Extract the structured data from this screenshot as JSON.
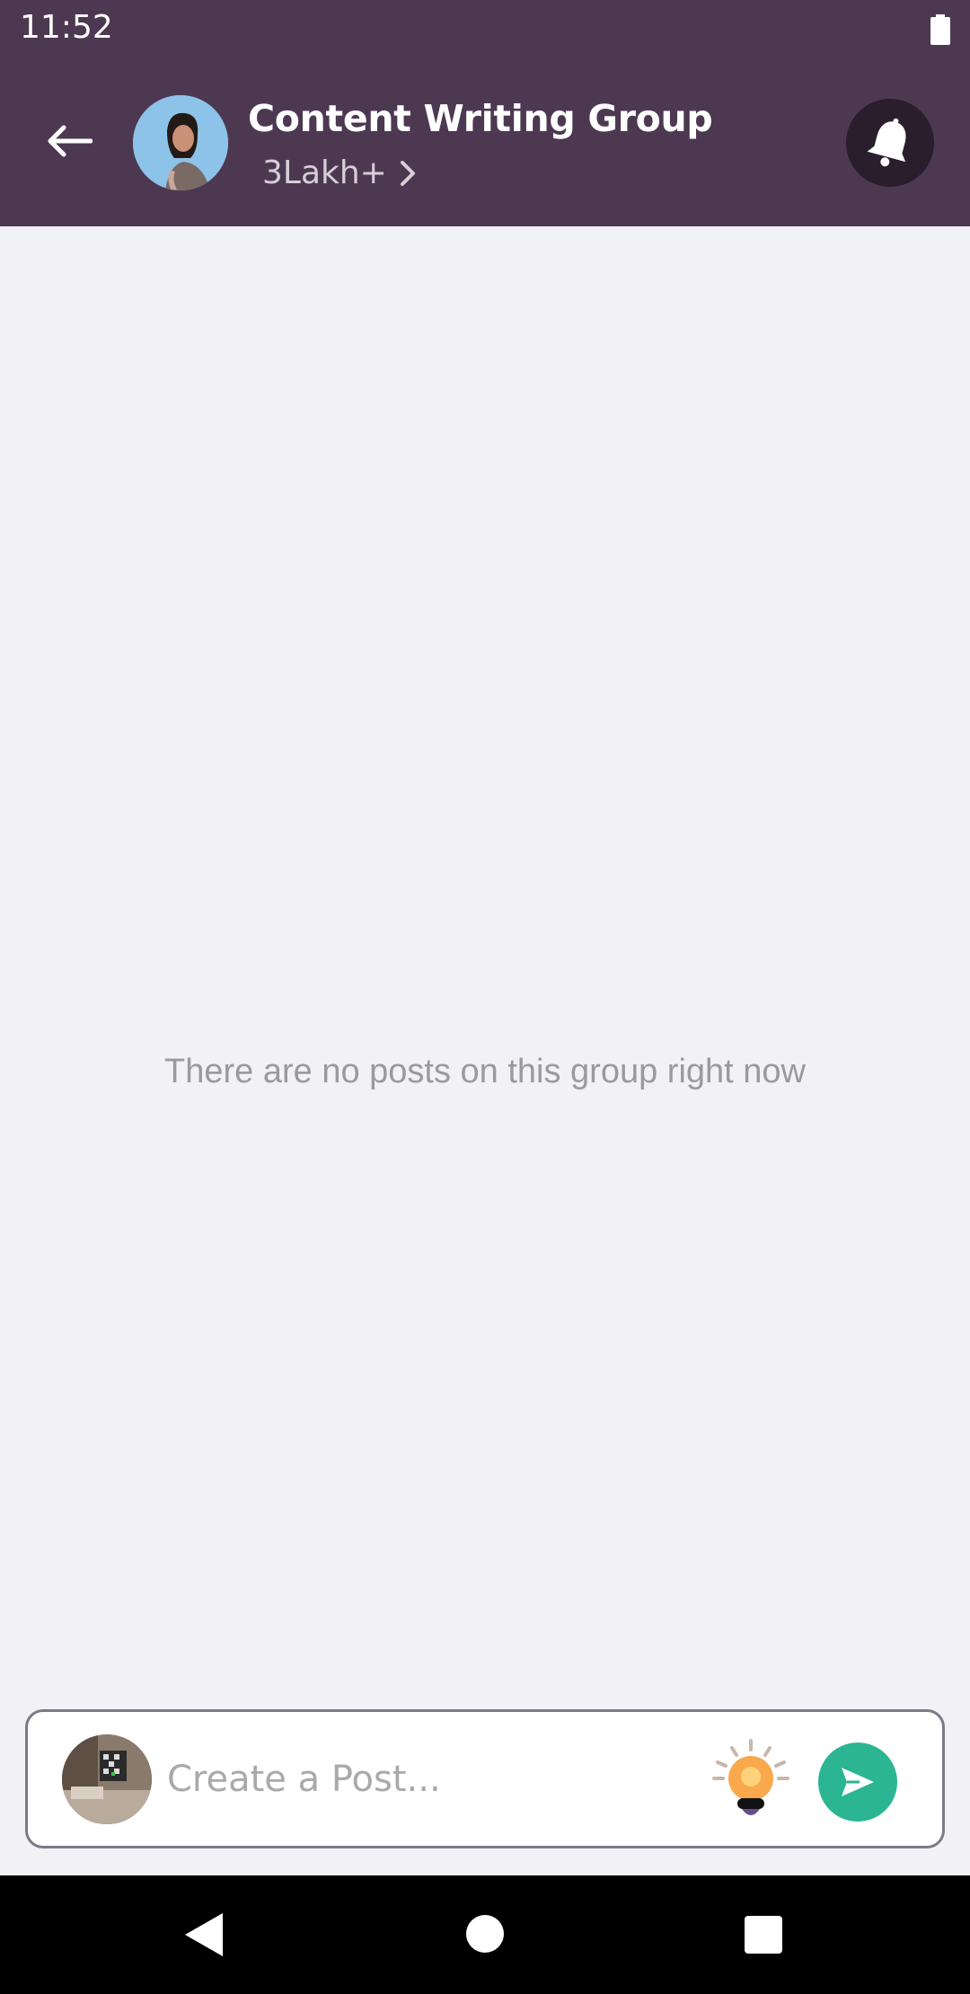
{
  "status_bar": {
    "time": "11:52"
  },
  "header": {
    "title": "Content Writing Group",
    "member_count": "3Lakh+",
    "icons": {
      "back": "back-arrow-icon",
      "chevron": "chevron-right-icon",
      "notifications": "bell-icon"
    },
    "colors": {
      "background": "#4d3851",
      "bell_bg": "#2a1d2c"
    }
  },
  "main": {
    "empty_message": "There are no posts on this group right now"
  },
  "composer": {
    "placeholder": "Create a Post...",
    "icons": {
      "idea": "lightbulb-icon",
      "send": "send-icon"
    },
    "colors": {
      "send_button": "#2bb592",
      "idea_bulb": "#f9a94b"
    }
  },
  "nav_bar": {
    "icons": [
      "nav-back-icon",
      "nav-home-icon",
      "nav-recents-icon"
    ]
  }
}
